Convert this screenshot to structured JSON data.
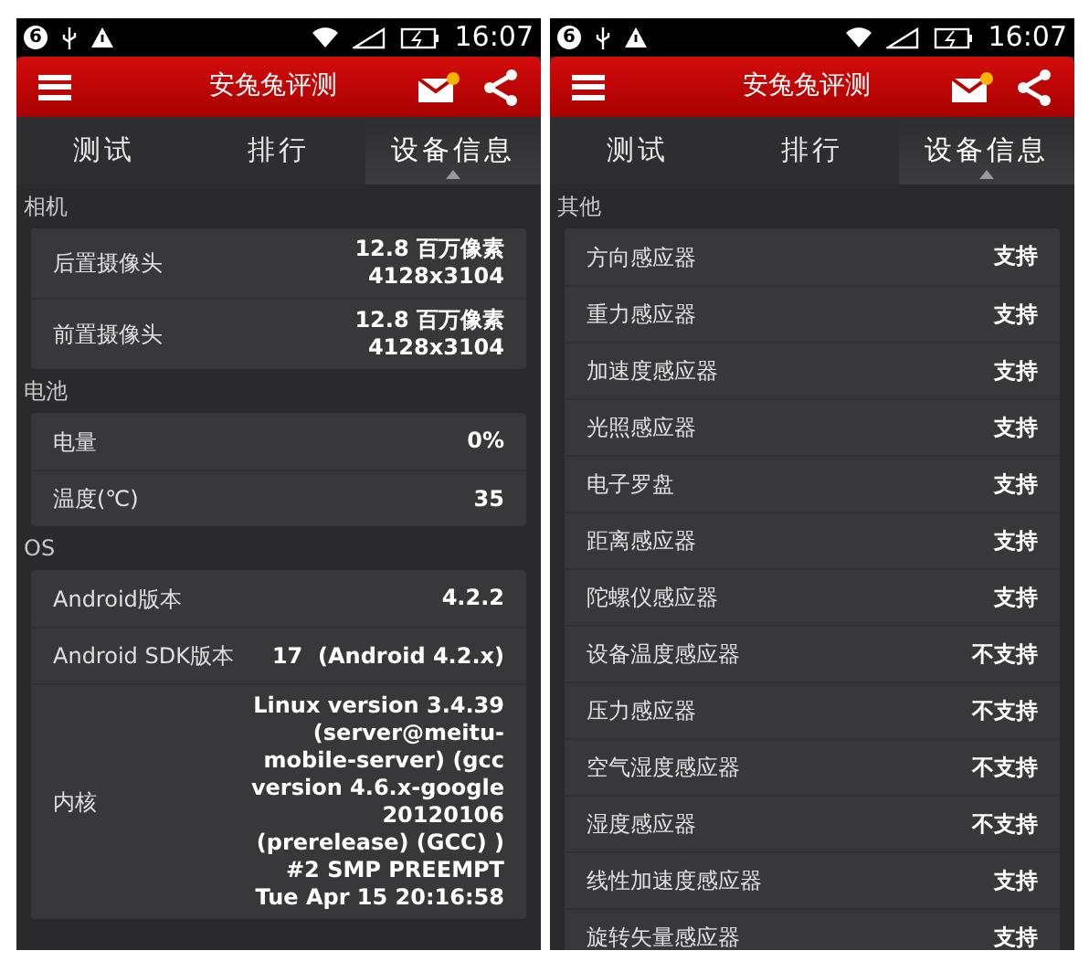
{
  "screens": [
    {
      "status_bar": {
        "notification_count": "6",
        "time": "16:07"
      },
      "app_bar": {
        "title": "安兔兔评测",
        "mail_unread": true
      },
      "tabs": [
        {
          "label": "测试",
          "selected": false
        },
        {
          "label": "排行",
          "selected": false
        },
        {
          "label": "设备信息",
          "selected": true
        }
      ],
      "sections": [
        {
          "title": "相机",
          "rows": [
            {
              "label": "后置摄像头",
              "value": "12.8 百万像素\n4128x3104"
            },
            {
              "label": "前置摄像头",
              "value": "12.8 百万像素\n4128x3104"
            }
          ]
        },
        {
          "title": "电池",
          "rows": [
            {
              "label": "电量",
              "value": "0%"
            },
            {
              "label": "温度(℃)",
              "value": "35"
            }
          ]
        },
        {
          "title": "OS",
          "rows": [
            {
              "label": "Android版本",
              "value": "4.2.2"
            },
            {
              "label": "Android SDK版本",
              "value": "17  (Android 4.2.x)"
            },
            {
              "label": "内核",
              "value": "Linux version 3.4.39\n(server@meitu-\nmobile-server) (gcc\nversion 4.6.x-google\n20120106\n(prerelease) (GCC) )\n#2 SMP PREEMPT\nTue Apr 15 20:16:58"
            }
          ]
        }
      ]
    },
    {
      "status_bar": {
        "notification_count": "6",
        "time": "16:07"
      },
      "app_bar": {
        "title": "安兔兔评测",
        "mail_unread": true
      },
      "tabs": [
        {
          "label": "测试",
          "selected": false
        },
        {
          "label": "排行",
          "selected": false
        },
        {
          "label": "设备信息",
          "selected": true
        }
      ],
      "sections": [
        {
          "title": "其他",
          "rows": [
            {
              "label": "方向感应器",
              "value": "支持"
            },
            {
              "label": "重力感应器",
              "value": "支持"
            },
            {
              "label": "加速度感应器",
              "value": "支持"
            },
            {
              "label": "光照感应器",
              "value": "支持"
            },
            {
              "label": "电子罗盘",
              "value": "支持"
            },
            {
              "label": "距离感应器",
              "value": "支持"
            },
            {
              "label": "陀螺仪感应器",
              "value": "支持"
            },
            {
              "label": "设备温度感应器",
              "value": "不支持"
            },
            {
              "label": "压力感应器",
              "value": "不支持"
            },
            {
              "label": "空气湿度感应器",
              "value": "不支持"
            },
            {
              "label": "湿度感应器",
              "value": "不支持"
            },
            {
              "label": "线性加速度感应器",
              "value": "支持"
            },
            {
              "label": "旋转矢量感应器",
              "value": "支持"
            }
          ]
        }
      ]
    }
  ]
}
